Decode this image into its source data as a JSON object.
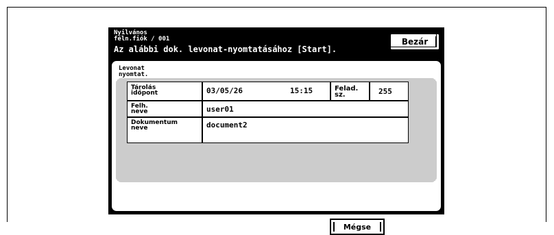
{
  "header": {
    "line1": "Nyilvános",
    "line2": "féln.fiók / 001",
    "instruction": "Az alábbi dok. levonat-nyomtatásához [Start]."
  },
  "close_label": "Bezár",
  "panel": {
    "title_line1": "Levonat",
    "title_line2": "nyomtat."
  },
  "info": {
    "stored_label_1": "Tárolás",
    "stored_label_2": "időpont",
    "stored_date": "03/05/26",
    "stored_time": "15:15",
    "job_label_1": "Felad.",
    "job_label_2": "sz.",
    "job_number": "255",
    "user_label_1": "Felh.",
    "user_label_2": "neve",
    "user_value": "user01",
    "doc_label_1": "Dokumentum",
    "doc_label_2": "neve",
    "doc_value": "document2"
  },
  "cancel_label": "Mégse"
}
